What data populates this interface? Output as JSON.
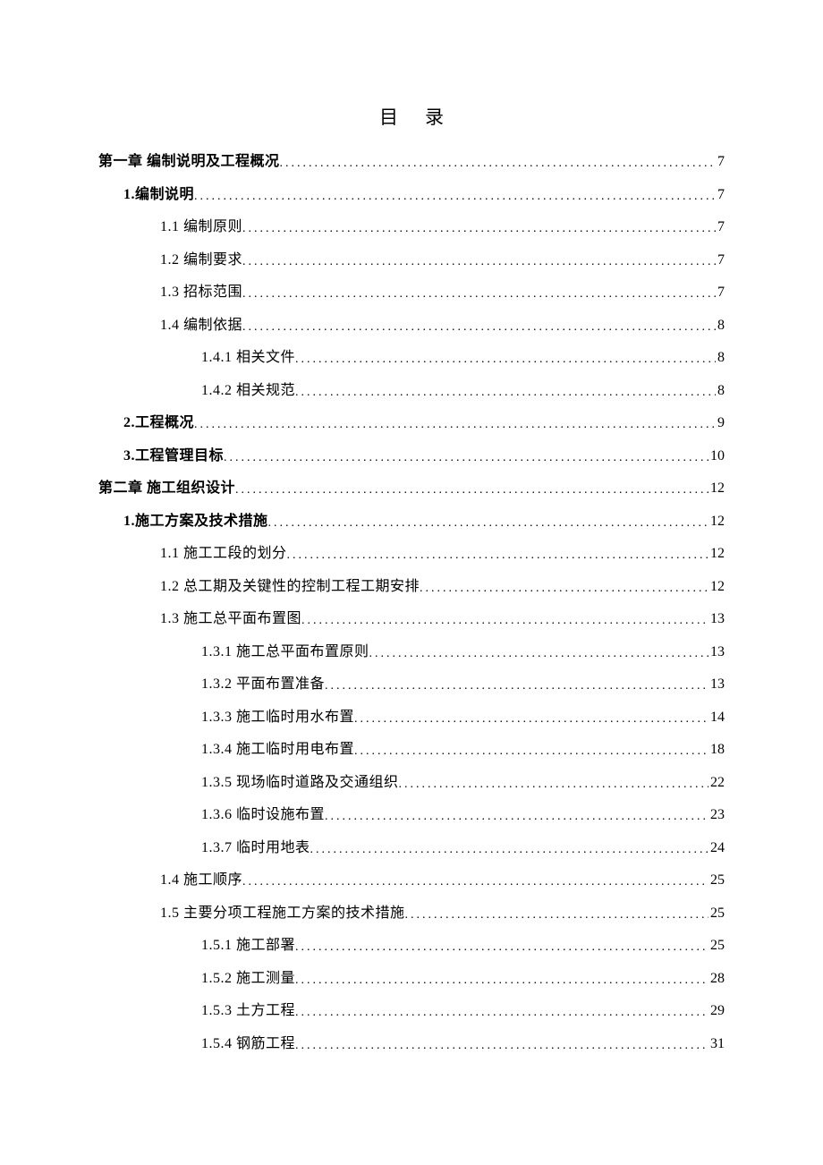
{
  "title": "目录",
  "toc": [
    {
      "label": "第一章 编制说明及工程概况",
      "page": "7",
      "indent": 0,
      "bold": true
    },
    {
      "label": "1.编制说明",
      "page": "7",
      "indent": 1,
      "bold": true
    },
    {
      "label": "1.1 编制原则",
      "page": "7",
      "indent": 2,
      "bold": false
    },
    {
      "label": "1.2 编制要求",
      "page": "7",
      "indent": 2,
      "bold": false
    },
    {
      "label": "1.3 招标范围",
      "page": "7",
      "indent": 2,
      "bold": false
    },
    {
      "label": "1.4 编制依据",
      "page": "8",
      "indent": 2,
      "bold": false
    },
    {
      "label": "1.4.1 相关文件",
      "page": "8",
      "indent": 3,
      "bold": false
    },
    {
      "label": "1.4.2 相关规范",
      "page": "8",
      "indent": 3,
      "bold": false
    },
    {
      "label": "2.工程概况",
      "page": "9",
      "indent": 1,
      "bold": true
    },
    {
      "label": "3.工程管理目标",
      "page": "10",
      "indent": 1,
      "bold": true
    },
    {
      "label": "第二章 施工组织设计",
      "page": "12",
      "indent": 0,
      "bold": true
    },
    {
      "label": "1.施工方案及技术措施",
      "page": "12",
      "indent": 1,
      "bold": true
    },
    {
      "label": "1.1 施工工段的划分",
      "page": "12",
      "indent": 2,
      "bold": false
    },
    {
      "label": "1.2 总工期及关键性的控制工程工期安排",
      "page": "12",
      "indent": 2,
      "bold": false
    },
    {
      "label": "1.3 施工总平面布置图",
      "page": "13",
      "indent": 2,
      "bold": false
    },
    {
      "label": "1.3.1 施工总平面布置原则",
      "page": "13",
      "indent": 3,
      "bold": false
    },
    {
      "label": "1.3.2 平面布置准备",
      "page": "13",
      "indent": 3,
      "bold": false
    },
    {
      "label": "1.3.3 施工临时用水布置",
      "page": "14",
      "indent": 3,
      "bold": false
    },
    {
      "label": "1.3.4 施工临时用电布置",
      "page": "18",
      "indent": 3,
      "bold": false
    },
    {
      "label": "1.3.5 现场临时道路及交通组织",
      "page": "22",
      "indent": 3,
      "bold": false
    },
    {
      "label": "1.3.6 临时设施布置",
      "page": "23",
      "indent": 3,
      "bold": false
    },
    {
      "label": "1.3.7 临时用地表",
      "page": "24",
      "indent": 3,
      "bold": false
    },
    {
      "label": "1.4 施工顺序",
      "page": "25",
      "indent": 2,
      "bold": false
    },
    {
      "label": "1.5 主要分项工程施工方案的技术措施",
      "page": "25",
      "indent": 2,
      "bold": false
    },
    {
      "label": "1.5.1 施工部署",
      "page": "25",
      "indent": 3,
      "bold": false
    },
    {
      "label": "1.5.2 施工测量",
      "page": "28",
      "indent": 3,
      "bold": false
    },
    {
      "label": "1.5.3 土方工程",
      "page": "29",
      "indent": 3,
      "bold": false
    },
    {
      "label": "1.5.4 钢筋工程",
      "page": "31",
      "indent": 3,
      "bold": false
    }
  ]
}
